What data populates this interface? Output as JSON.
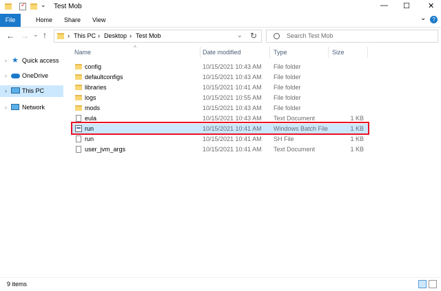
{
  "window": {
    "title": "Test Mob",
    "controls": {
      "minimize": "—",
      "maximize": "☐",
      "close": "✕"
    },
    "help": "?",
    "chevron": "⌄"
  },
  "ribbon": {
    "tabs": [
      "File",
      "Home",
      "Share",
      "View"
    ]
  },
  "nav": {
    "back": "←",
    "forward": "→",
    "recent": "⌄",
    "up": "↑",
    "refresh": "↻",
    "dropdown": "⌄"
  },
  "address": {
    "crumbs": [
      "This PC",
      "Desktop",
      "Test Mob"
    ],
    "separator": "›"
  },
  "search": {
    "placeholder": "Search Test Mob"
  },
  "sidebar": {
    "items": [
      {
        "label": "Quick access",
        "icon": "star-icon",
        "selected": false
      },
      {
        "label": "OneDrive",
        "icon": "cloud-icon",
        "selected": false
      },
      {
        "label": "This PC",
        "icon": "computer-icon",
        "selected": true
      },
      {
        "label": "Network",
        "icon": "network-icon",
        "selected": false
      }
    ]
  },
  "columns": {
    "name": "Name",
    "date": "Date modified",
    "type": "Type",
    "size": "Size",
    "sort_indicator": "^"
  },
  "files": [
    {
      "name": "config",
      "date": "10/15/2021 10:43 AM",
      "type": "File folder",
      "size": "",
      "icon": "folder-icon"
    },
    {
      "name": "defaultconfigs",
      "date": "10/15/2021 10:43 AM",
      "type": "File folder",
      "size": "",
      "icon": "folder-icon"
    },
    {
      "name": "libraries",
      "date": "10/15/2021 10:41 AM",
      "type": "File folder",
      "size": "",
      "icon": "folder-icon"
    },
    {
      "name": "logs",
      "date": "10/15/2021 10:55 AM",
      "type": "File folder",
      "size": "",
      "icon": "folder-icon"
    },
    {
      "name": "mods",
      "date": "10/15/2021 10:43 AM",
      "type": "File folder",
      "size": "",
      "icon": "folder-icon"
    },
    {
      "name": "eula",
      "date": "10/15/2021 10:43 AM",
      "type": "Text Document",
      "size": "1 KB",
      "icon": "text-document-icon"
    },
    {
      "name": "run",
      "date": "10/15/2021 10:41 AM",
      "type": "Windows Batch File",
      "size": "1 KB",
      "icon": "batch-file-icon"
    },
    {
      "name": "run",
      "date": "10/15/2021 10:41 AM",
      "type": "SH File",
      "size": "1 KB",
      "icon": "document-icon"
    },
    {
      "name": "user_jvm_args",
      "date": "10/15/2021 10:41 AM",
      "type": "Text Document",
      "size": "1 KB",
      "icon": "text-document-icon"
    }
  ],
  "status": {
    "count": "9 items"
  },
  "colors": {
    "accent": "#1979ca",
    "selection": "#cce8ff",
    "highlight": "#e81123"
  }
}
